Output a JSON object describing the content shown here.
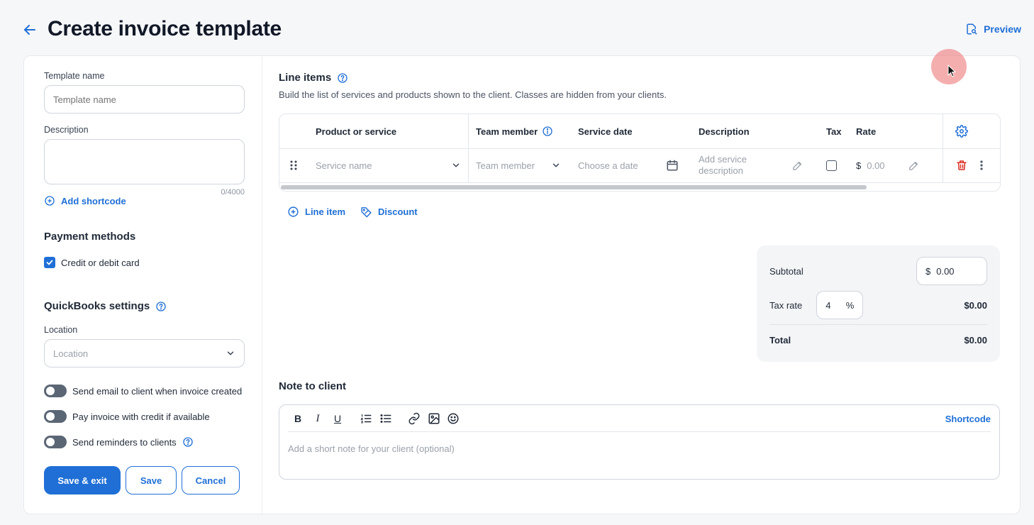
{
  "header": {
    "title": "Create invoice template",
    "preview_label": "Preview"
  },
  "left": {
    "template_name": {
      "label": "Template name",
      "placeholder": "Template name",
      "value": ""
    },
    "description": {
      "label": "Description",
      "value": "",
      "counter": "0/4000"
    },
    "add_shortcode_label": "Add shortcode",
    "payment": {
      "heading": "Payment methods",
      "card_label": "Credit or debit card",
      "card_checked": true
    },
    "quickbooks": {
      "heading": "QuickBooks settings",
      "location_label": "Location",
      "location_placeholder": "Location"
    },
    "toggles": [
      {
        "label": "Send email to client when invoice created",
        "on": false
      },
      {
        "label": "Pay invoice with credit if available",
        "on": false
      },
      {
        "label": "Send reminders to clients",
        "on": false
      }
    ],
    "buttons": {
      "save_exit": "Save & exit",
      "save": "Save",
      "cancel": "Cancel"
    }
  },
  "line_items": {
    "heading": "Line items",
    "subtitle": "Build the list of services and products shown to the client. Classes are hidden from your clients.",
    "columns": {
      "product": "Product or service",
      "team": "Team member",
      "date": "Service date",
      "description": "Description",
      "tax": "Tax",
      "rate": "Rate"
    },
    "row": {
      "service_placeholder": "Service name",
      "team_placeholder": "Team member",
      "date_placeholder": "Choose a date",
      "description_placeholder": "Add service description",
      "currency": "$",
      "rate_placeholder": "0.00"
    },
    "add_line_item": "Line item",
    "add_discount": "Discount"
  },
  "totals": {
    "subtotal_label": "Subtotal",
    "subtotal_currency": "$",
    "subtotal_value": "0.00",
    "tax_rate_label": "Tax rate",
    "tax_rate_value": "4",
    "tax_rate_unit": "%",
    "tax_amount": "$0.00",
    "total_label": "Total",
    "total_value": "$0.00"
  },
  "note": {
    "heading": "Note to client",
    "shortcode_label": "Shortcode",
    "placeholder": "Add a short note for your client (optional)"
  },
  "colors": {
    "accent": "#1f6fd6",
    "danger": "#d92d20",
    "toggle_off": "#5b6675"
  }
}
